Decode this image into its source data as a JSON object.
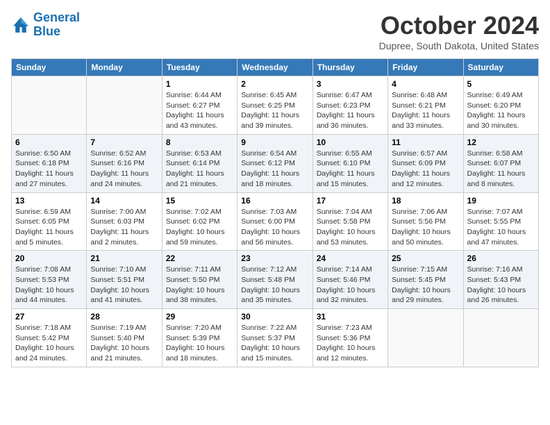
{
  "header": {
    "logo_line1": "General",
    "logo_line2": "Blue",
    "month_title": "October 2024",
    "location": "Dupree, South Dakota, United States"
  },
  "weekdays": [
    "Sunday",
    "Monday",
    "Tuesday",
    "Wednesday",
    "Thursday",
    "Friday",
    "Saturday"
  ],
  "weeks": [
    [
      {
        "day": "",
        "detail": ""
      },
      {
        "day": "",
        "detail": ""
      },
      {
        "day": "1",
        "detail": "Sunrise: 6:44 AM\nSunset: 6:27 PM\nDaylight: 11 hours and 43 minutes."
      },
      {
        "day": "2",
        "detail": "Sunrise: 6:45 AM\nSunset: 6:25 PM\nDaylight: 11 hours and 39 minutes."
      },
      {
        "day": "3",
        "detail": "Sunrise: 6:47 AM\nSunset: 6:23 PM\nDaylight: 11 hours and 36 minutes."
      },
      {
        "day": "4",
        "detail": "Sunrise: 6:48 AM\nSunset: 6:21 PM\nDaylight: 11 hours and 33 minutes."
      },
      {
        "day": "5",
        "detail": "Sunrise: 6:49 AM\nSunset: 6:20 PM\nDaylight: 11 hours and 30 minutes."
      }
    ],
    [
      {
        "day": "6",
        "detail": "Sunrise: 6:50 AM\nSunset: 6:18 PM\nDaylight: 11 hours and 27 minutes."
      },
      {
        "day": "7",
        "detail": "Sunrise: 6:52 AM\nSunset: 6:16 PM\nDaylight: 11 hours and 24 minutes."
      },
      {
        "day": "8",
        "detail": "Sunrise: 6:53 AM\nSunset: 6:14 PM\nDaylight: 11 hours and 21 minutes."
      },
      {
        "day": "9",
        "detail": "Sunrise: 6:54 AM\nSunset: 6:12 PM\nDaylight: 11 hours and 18 minutes."
      },
      {
        "day": "10",
        "detail": "Sunrise: 6:55 AM\nSunset: 6:10 PM\nDaylight: 11 hours and 15 minutes."
      },
      {
        "day": "11",
        "detail": "Sunrise: 6:57 AM\nSunset: 6:09 PM\nDaylight: 11 hours and 12 minutes."
      },
      {
        "day": "12",
        "detail": "Sunrise: 6:58 AM\nSunset: 6:07 PM\nDaylight: 11 hours and 8 minutes."
      }
    ],
    [
      {
        "day": "13",
        "detail": "Sunrise: 6:59 AM\nSunset: 6:05 PM\nDaylight: 11 hours and 5 minutes."
      },
      {
        "day": "14",
        "detail": "Sunrise: 7:00 AM\nSunset: 6:03 PM\nDaylight: 11 hours and 2 minutes."
      },
      {
        "day": "15",
        "detail": "Sunrise: 7:02 AM\nSunset: 6:02 PM\nDaylight: 10 hours and 59 minutes."
      },
      {
        "day": "16",
        "detail": "Sunrise: 7:03 AM\nSunset: 6:00 PM\nDaylight: 10 hours and 56 minutes."
      },
      {
        "day": "17",
        "detail": "Sunrise: 7:04 AM\nSunset: 5:58 PM\nDaylight: 10 hours and 53 minutes."
      },
      {
        "day": "18",
        "detail": "Sunrise: 7:06 AM\nSunset: 5:56 PM\nDaylight: 10 hours and 50 minutes."
      },
      {
        "day": "19",
        "detail": "Sunrise: 7:07 AM\nSunset: 5:55 PM\nDaylight: 10 hours and 47 minutes."
      }
    ],
    [
      {
        "day": "20",
        "detail": "Sunrise: 7:08 AM\nSunset: 5:53 PM\nDaylight: 10 hours and 44 minutes."
      },
      {
        "day": "21",
        "detail": "Sunrise: 7:10 AM\nSunset: 5:51 PM\nDaylight: 10 hours and 41 minutes."
      },
      {
        "day": "22",
        "detail": "Sunrise: 7:11 AM\nSunset: 5:50 PM\nDaylight: 10 hours and 38 minutes."
      },
      {
        "day": "23",
        "detail": "Sunrise: 7:12 AM\nSunset: 5:48 PM\nDaylight: 10 hours and 35 minutes."
      },
      {
        "day": "24",
        "detail": "Sunrise: 7:14 AM\nSunset: 5:46 PM\nDaylight: 10 hours and 32 minutes."
      },
      {
        "day": "25",
        "detail": "Sunrise: 7:15 AM\nSunset: 5:45 PM\nDaylight: 10 hours and 29 minutes."
      },
      {
        "day": "26",
        "detail": "Sunrise: 7:16 AM\nSunset: 5:43 PM\nDaylight: 10 hours and 26 minutes."
      }
    ],
    [
      {
        "day": "27",
        "detail": "Sunrise: 7:18 AM\nSunset: 5:42 PM\nDaylight: 10 hours and 24 minutes."
      },
      {
        "day": "28",
        "detail": "Sunrise: 7:19 AM\nSunset: 5:40 PM\nDaylight: 10 hours and 21 minutes."
      },
      {
        "day": "29",
        "detail": "Sunrise: 7:20 AM\nSunset: 5:39 PM\nDaylight: 10 hours and 18 minutes."
      },
      {
        "day": "30",
        "detail": "Sunrise: 7:22 AM\nSunset: 5:37 PM\nDaylight: 10 hours and 15 minutes."
      },
      {
        "day": "31",
        "detail": "Sunrise: 7:23 AM\nSunset: 5:36 PM\nDaylight: 10 hours and 12 minutes."
      },
      {
        "day": "",
        "detail": ""
      },
      {
        "day": "",
        "detail": ""
      }
    ]
  ]
}
